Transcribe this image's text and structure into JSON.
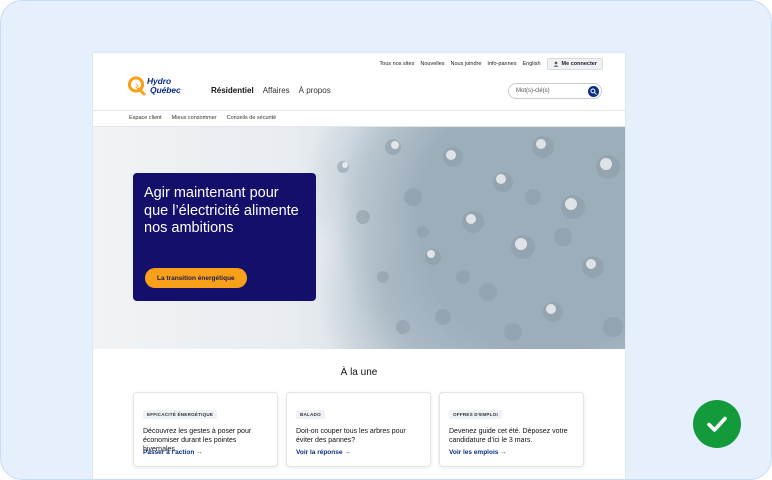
{
  "utility": {
    "links": [
      "Tous nos sites",
      "Nouvelles",
      "Nous joindre",
      "Info-pannes",
      "English"
    ],
    "login_label": "Me connecter"
  },
  "brand": {
    "line1": "Hydro",
    "line2": "Québec",
    "color": "#0a2e88",
    "accent": "#f9a01b"
  },
  "nav": {
    "items": [
      "Résidentiel",
      "Affaires",
      "À propos"
    ],
    "active": "Résidentiel"
  },
  "search": {
    "placeholder": "Mot(s)-clé(s)"
  },
  "subnav": {
    "items": [
      "Espace client",
      "Mieux consommer",
      "Conseils de sécurité"
    ]
  },
  "hero": {
    "title": "Agir maintenant pour que l’électricité alimente nos ambitions",
    "cta_label": "La transition énergétique",
    "card_color": "#140f6b"
  },
  "news": {
    "title": "À la une",
    "tiles": [
      {
        "tag": "EFFICACITÉ ÉNERGÉTIQUE",
        "text": "Découvrez les gestes à poser pour économiser durant les pointes hivernales.",
        "link": "Passer à l’action →"
      },
      {
        "tag": "BALADO",
        "text": "Doit-on couper tous les arbres pour éviter des pannes?",
        "link": "Voir la réponse →"
      },
      {
        "tag": "OFFRES D'EMPLOI",
        "text": "Devenez guide cet été. Déposez votre candidature d’ici le 3 mars.",
        "link": "Voir les emplois →"
      }
    ]
  },
  "badge": {
    "icon": "check-icon",
    "color": "#139b3b"
  }
}
